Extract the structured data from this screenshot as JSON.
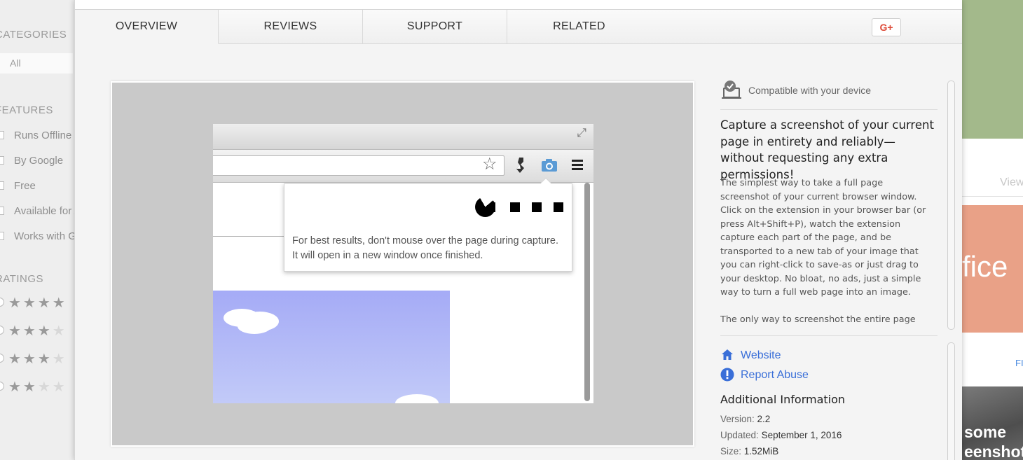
{
  "left_sidebar": {
    "categories_heading": "CATEGORIES",
    "all_label": "All",
    "features_heading": "FEATURES",
    "features": [
      "Runs Offline",
      "By Google",
      "Free",
      "Available for Android",
      "Works with Google Drive"
    ],
    "ratings_heading": "RATINGS",
    "ratings": [
      4,
      3,
      3,
      2
    ]
  },
  "right_background": {
    "view_text": "View",
    "tile_text": "fice",
    "link_text": "FI",
    "photo_lines": [
      "some",
      "eenshot"
    ]
  },
  "tabs": [
    {
      "label": "OVERVIEW",
      "active": true
    },
    {
      "label": "REVIEWS",
      "active": false
    },
    {
      "label": "SUPPORT",
      "active": false
    },
    {
      "label": "RELATED",
      "active": false
    }
  ],
  "share": {
    "gplus_label": "G+"
  },
  "screenshot": {
    "popup_text": "For best results, don't mouse over the page during capture. It will open in a new window once finished."
  },
  "details": {
    "compatibility": "Compatible with your device",
    "headline": "Capture a screenshot of your current page in entirety and reliably—without requesting any extra permissions!",
    "description": [
      "The simplest way to take a full page screenshot of your current browser window. Click on the extension in your browser bar (or press Alt+Shift+P), watch the extension capture each part of the page, and be transported to a new tab of your image that you can right-click to save-as or just drag to your desktop. No bloat, no ads, just a simple way to turn a full web page into an image.",
      "The only way to screenshot the entire page reliably and without requesting any extra permissions!"
    ],
    "links": {
      "website": "Website",
      "report_abuse": "Report Abuse"
    },
    "additional_heading": "Additional Information",
    "version_label": "Version:",
    "version": "2.2",
    "updated_label": "Updated:",
    "updated": "September 1, 2016",
    "size_label": "Size:",
    "size": "1.52MiB"
  },
  "colors": {
    "link": "#3a6fd8",
    "gplus": "#dd4b39",
    "sky": "#a5abf6",
    "camera_icon": "#5b9bd5"
  }
}
